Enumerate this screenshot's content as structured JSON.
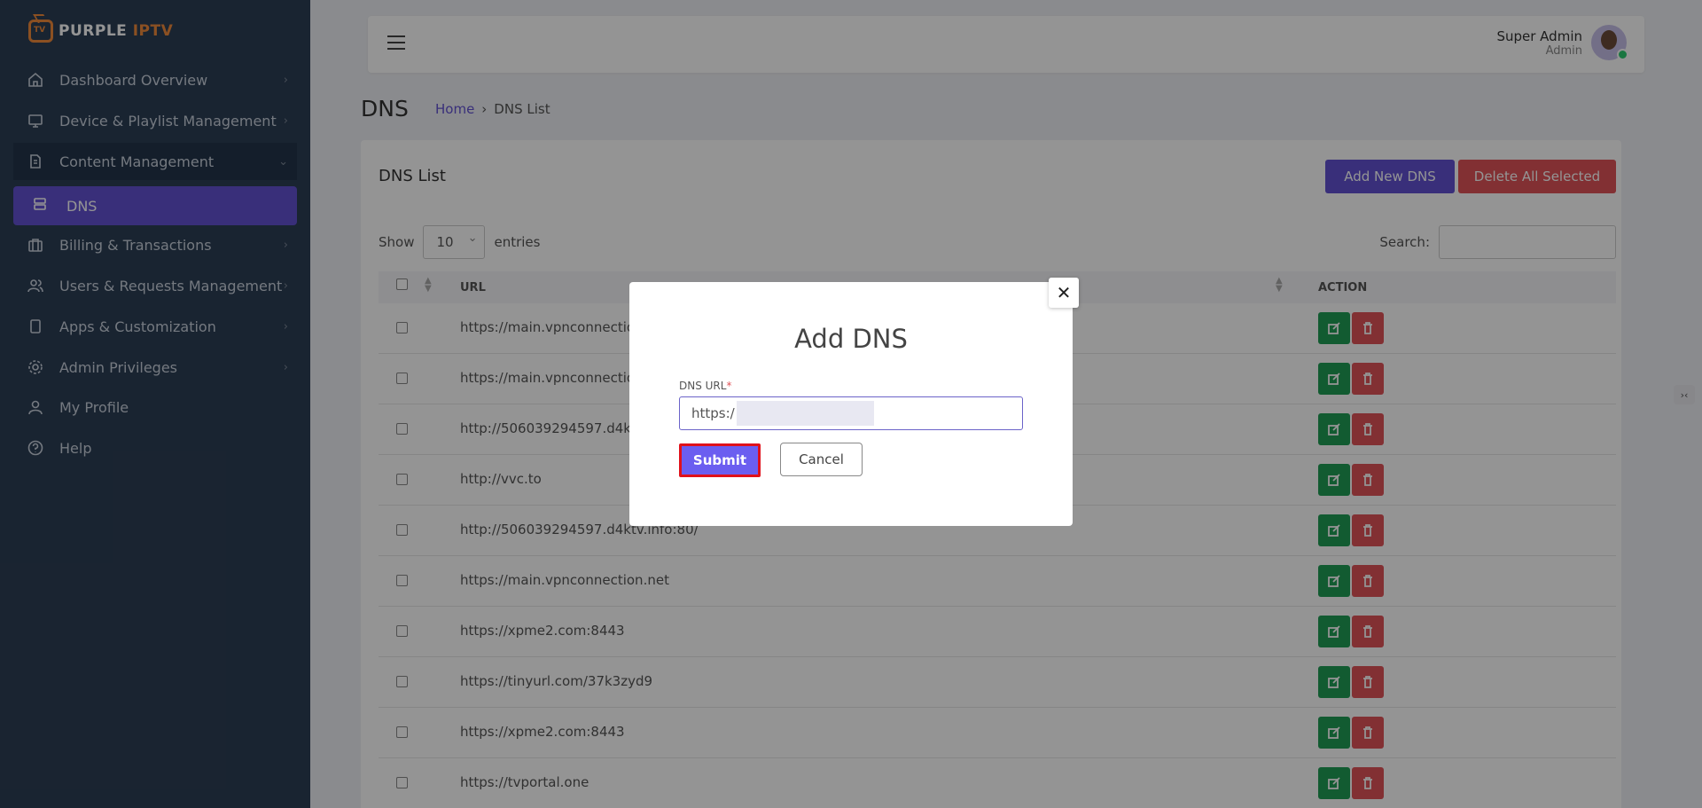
{
  "app": {
    "logo_prefix": "PURPLE",
    "logo_suffix": "IPTV",
    "logo_tv": "TV"
  },
  "sidebar": {
    "items": [
      {
        "label": "Dashboard Overview",
        "icon": "home-icon"
      },
      {
        "label": "Device & Playlist Management",
        "icon": "monitor-icon"
      },
      {
        "label": "Content Management",
        "icon": "document-icon"
      },
      {
        "label": "Billing & Transactions",
        "icon": "briefcase-icon"
      },
      {
        "label": "Users & Requests Management",
        "icon": "users-icon"
      },
      {
        "label": "Apps & Customization",
        "icon": "tablet-icon"
      },
      {
        "label": "Admin Privileges",
        "icon": "gear-icon"
      },
      {
        "label": "My Profile",
        "icon": "user-icon"
      },
      {
        "label": "Help",
        "icon": "help-icon"
      }
    ],
    "sub_item": {
      "label": "DNS",
      "icon": "server-icon"
    }
  },
  "header": {
    "user_name": "Super Admin",
    "user_role": "Admin"
  },
  "page": {
    "title": "DNS",
    "breadcrumb_home": "Home",
    "breadcrumb_current": "DNS List"
  },
  "card": {
    "title": "DNS List",
    "add_button": "Add New DNS",
    "delete_button": "Delete All Selected",
    "show_label": "Show",
    "entries_value": "10",
    "entries_label": "entries",
    "search_label": "Search:"
  },
  "table": {
    "columns": {
      "url": "URL",
      "action": "ACTION"
    },
    "rows": [
      {
        "url": "https://main.vpnconnection.net"
      },
      {
        "url": "https://main.vpnconnection.net"
      },
      {
        "url": "http://506039294597.d4ktv.info:80/"
      },
      {
        "url": "http://vvc.to"
      },
      {
        "url": "http://506039294597.d4ktv.info:80/"
      },
      {
        "url": "https://main.vpnconnection.net"
      },
      {
        "url": "https://xpme2.com:8443"
      },
      {
        "url": "https://tinyurl.com/37k3zyd9"
      },
      {
        "url": "https://xpme2.com:8443"
      },
      {
        "url": "https://tvportal.one"
      }
    ]
  },
  "modal": {
    "title": "Add DNS",
    "field_label": "DNS URL",
    "required_mark": "*",
    "field_value": "https:/",
    "submit_label": "Submit",
    "cancel_label": "Cancel"
  },
  "colors": {
    "sidebar_bg": "#2c3e55",
    "accent": "#6252d3",
    "danger": "#e05458",
    "success": "#1f9d55",
    "highlight": "#e0111b"
  }
}
